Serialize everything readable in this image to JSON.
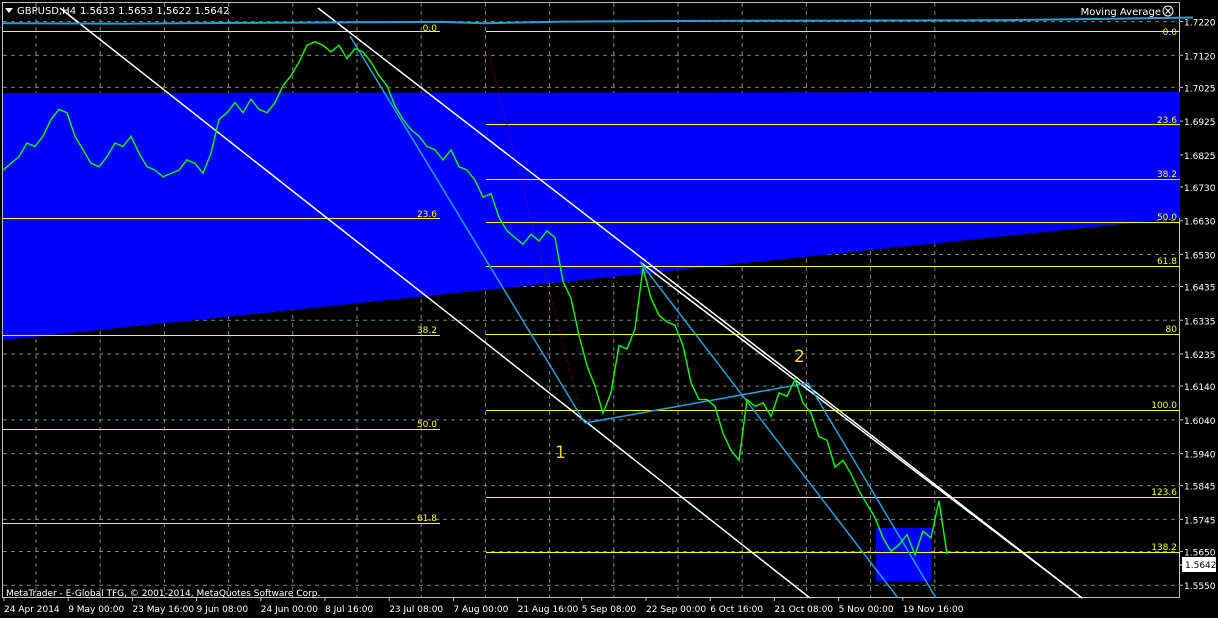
{
  "header": {
    "symbol_label": "GBPUSD,H4",
    "ohlc": "1.5633 1.5653 1.5622 1.5642",
    "indicator": "Moving Average"
  },
  "copyright": "MetaTrader - E-Global TFG, © 2001-2014, MetaQuotes Software Corp.",
  "current_price": "1.5642",
  "colors": {
    "background": "#000000",
    "price_line": "#00ff00",
    "grid": "#c0c0c0",
    "fib": "#ffff00",
    "zone": "#0000ff",
    "channel_white": "#ffffff",
    "channel_cyan": "#1e9fe0",
    "moving_average": "#1e9fe0"
  },
  "chart_data": {
    "type": "line",
    "ylim": [
      1.5515,
      1.7275
    ],
    "y_ticks": [
      "1.7220",
      "1.7120",
      "1.7025",
      "1.6925",
      "1.6825",
      "1.6730",
      "1.6630",
      "1.6530",
      "1.6435",
      "1.6335",
      "1.6235",
      "1.6140",
      "1.6040",
      "1.5940",
      "1.5845",
      "1.5745",
      "1.5650",
      "1.5550"
    ],
    "x_ticks": [
      "24 Apr 2014",
      "9 May 00:00",
      "23 May 16:00",
      "9 Jun 08:00",
      "24 Jun 00:00",
      "8 Jul 16:00",
      "23 Jul 08:00",
      "7 Aug 00:00",
      "21 Aug 16:00",
      "5 Sep 08:00",
      "22 Sep 00:00",
      "6 Oct 16:00",
      "21 Oct 08:00",
      "5 Nov 00:00",
      "19 Nov 16:00"
    ],
    "series": [
      {
        "name": "GBPUSD",
        "x": [
          0,
          8,
          16,
          24,
          32,
          40,
          48,
          56,
          64,
          72,
          80,
          88,
          96,
          104,
          112,
          120,
          128,
          136,
          144,
          152,
          160,
          168,
          176,
          184,
          192,
          200,
          208,
          216,
          224,
          232,
          240,
          248,
          256,
          264,
          272,
          280,
          288,
          296,
          304,
          312,
          320,
          328,
          336,
          344,
          352,
          360,
          368,
          376,
          384,
          392,
          400,
          408,
          416,
          424,
          432,
          440,
          448,
          456,
          464,
          472,
          480,
          488,
          496,
          504,
          512,
          520,
          528,
          536,
          544,
          552,
          560,
          568,
          576,
          584,
          592,
          600,
          608,
          616,
          624,
          632,
          640,
          648,
          656,
          664,
          672,
          680,
          688,
          696,
          704,
          712,
          720,
          728,
          736,
          744,
          752,
          760,
          768,
          776,
          784,
          792,
          800,
          808,
          816,
          824,
          832,
          840,
          848,
          856,
          864,
          872,
          880,
          888,
          896,
          904,
          912,
          920,
          928,
          936,
          944
        ],
        "values": [
          1.678,
          1.68,
          1.682,
          1.686,
          1.685,
          1.688,
          1.693,
          1.696,
          1.695,
          1.688,
          1.684,
          1.68,
          1.679,
          1.682,
          1.686,
          1.685,
          1.688,
          1.683,
          1.679,
          1.678,
          1.676,
          1.677,
          1.678,
          1.681,
          1.68,
          1.677,
          1.683,
          1.693,
          1.695,
          1.698,
          1.695,
          1.699,
          1.696,
          1.695,
          1.698,
          1.703,
          1.706,
          1.71,
          1.715,
          1.716,
          1.715,
          1.713,
          1.715,
          1.711,
          1.714,
          1.713,
          1.71,
          1.706,
          1.703,
          1.697,
          1.693,
          1.69,
          1.688,
          1.685,
          1.684,
          1.681,
          1.684,
          1.679,
          1.678,
          1.675,
          1.67,
          1.671,
          1.664,
          1.66,
          1.658,
          1.656,
          1.659,
          1.657,
          1.66,
          1.658,
          1.645,
          1.64,
          1.629,
          1.62,
          1.614,
          1.606,
          1.612,
          1.626,
          1.625,
          1.631,
          1.649,
          1.64,
          1.635,
          1.633,
          1.632,
          1.626,
          1.615,
          1.61,
          1.61,
          1.608,
          1.6,
          1.595,
          1.592,
          1.61,
          1.608,
          1.609,
          1.605,
          1.612,
          1.611,
          1.616,
          1.609,
          1.606,
          1.599,
          1.598,
          1.59,
          1.592,
          1.588,
          1.583,
          1.579,
          1.575,
          1.569,
          1.565,
          1.567,
          1.57,
          1.564,
          1.571,
          1.569,
          1.58,
          1.5642
        ]
      },
      {
        "name": "Moving Average",
        "x": [
          0,
          120,
          240,
          360,
          440,
          480,
          560,
          700,
          840,
          1000,
          1100,
          1190
        ],
        "values": [
          1.7215,
          1.7214,
          1.7216,
          1.7218,
          1.7219,
          1.7215,
          1.722,
          1.7222,
          1.7223,
          1.7224,
          1.7228,
          1.7232
        ]
      }
    ],
    "fib_levels": {
      "left": [
        "0.0",
        "23.6",
        "38.2",
        "50.0",
        "61.8"
      ],
      "right": [
        "0.0",
        "23.6",
        "38.2",
        "50.0",
        "61.8",
        "80",
        "100.0",
        "123.6",
        "138.2"
      ]
    },
    "wave_labels": [
      "1",
      "2"
    ]
  }
}
